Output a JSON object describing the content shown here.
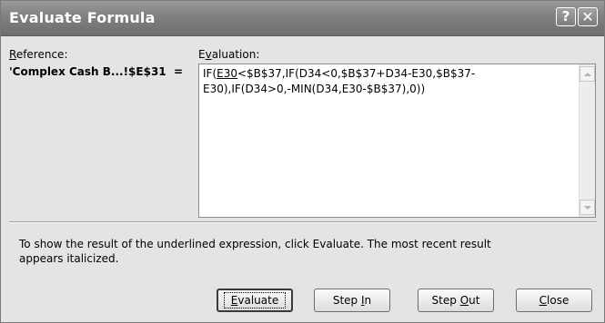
{
  "window": {
    "title": "Evaluate Formula",
    "help_glyph": "?",
    "close_glyph": "✕"
  },
  "reference": {
    "label_accel": "R",
    "label_rest": "eference:",
    "value": "'Complex Cash B...!$E$31",
    "equals": "="
  },
  "evaluation": {
    "label_pre": "E",
    "label_accel": "v",
    "label_rest": "aluation:",
    "formula_prefix": "IF(",
    "formula_underlined": "E30",
    "formula_rest": "<$B$37,IF(D34<0,$B$37+D34-E30,$B$37-E30),IF(D34>0,-MIN(D34,E30-$B$37),0))"
  },
  "info_text": "To show the result of the underlined expression, click Evaluate.  The most recent result appears italicized.",
  "buttons": {
    "evaluate": {
      "accel": "E",
      "rest": "valuate"
    },
    "step_in": {
      "pre": "Step ",
      "accel": "I",
      "rest": "n"
    },
    "step_out": {
      "pre": "Step ",
      "accel": "O",
      "rest": "ut"
    },
    "close": {
      "accel": "C",
      "rest": "lose"
    }
  },
  "icons": {
    "scroll_up": "scroll-up-arrow-icon",
    "scroll_down": "scroll-down-arrow-icon"
  },
  "colors": {
    "titlebar": "#808080",
    "dialog_bg": "#e4e4e4"
  }
}
